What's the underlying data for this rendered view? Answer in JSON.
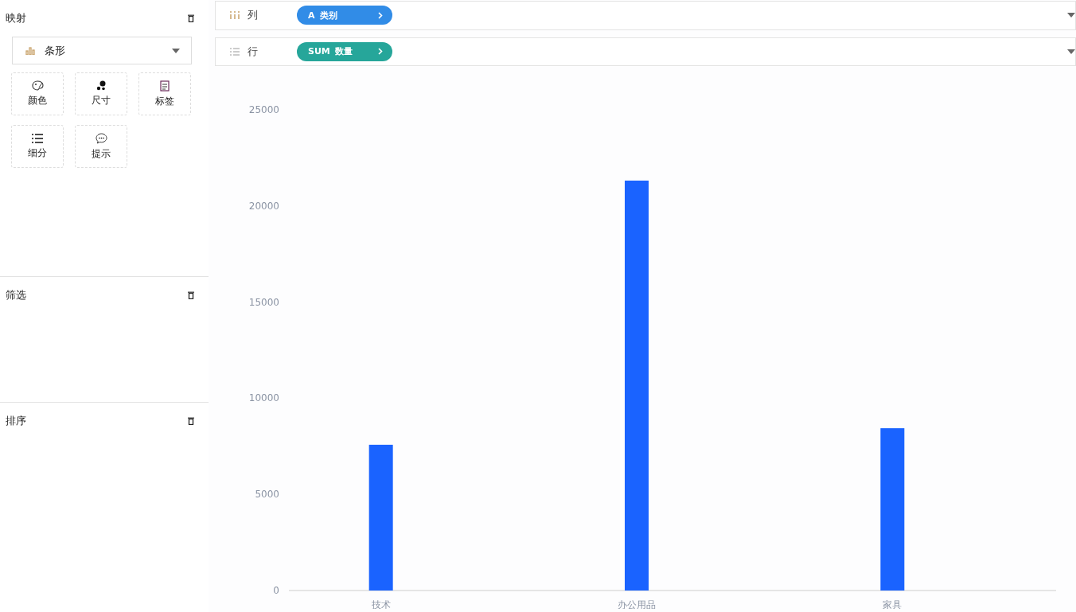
{
  "sidebar": {
    "sections": [
      {
        "title": "映射",
        "kind": "mapping"
      },
      {
        "title": "筛选",
        "kind": "plain"
      },
      {
        "title": "排序",
        "kind": "plain"
      }
    ],
    "chart_type": {
      "label": "条形"
    },
    "mapping_tiles": [
      {
        "label": "颜色",
        "kind": "color"
      },
      {
        "label": "尺寸",
        "kind": "size"
      },
      {
        "label": "标签",
        "kind": "label"
      },
      {
        "label": "细分",
        "kind": "detail"
      },
      {
        "label": "提示",
        "kind": "tooltip"
      }
    ]
  },
  "shelves": [
    {
      "label": "列",
      "kind": "columns",
      "pill": {
        "prefix": "A",
        "name": "类别",
        "color": "#318ce7"
      }
    },
    {
      "label": "行",
      "kind": "rows",
      "pill": {
        "prefix": "SUM",
        "name": "数量",
        "color": "#26a69a"
      }
    }
  ],
  "chart_data": {
    "type": "bar",
    "categories": [
      "技术",
      "办公用品",
      "家具"
    ],
    "values": [
      7580,
      21320,
      8440
    ],
    "ylim": [
      0,
      25000
    ],
    "yticks": [
      0,
      5000,
      10000,
      15000,
      20000,
      25000
    ]
  }
}
